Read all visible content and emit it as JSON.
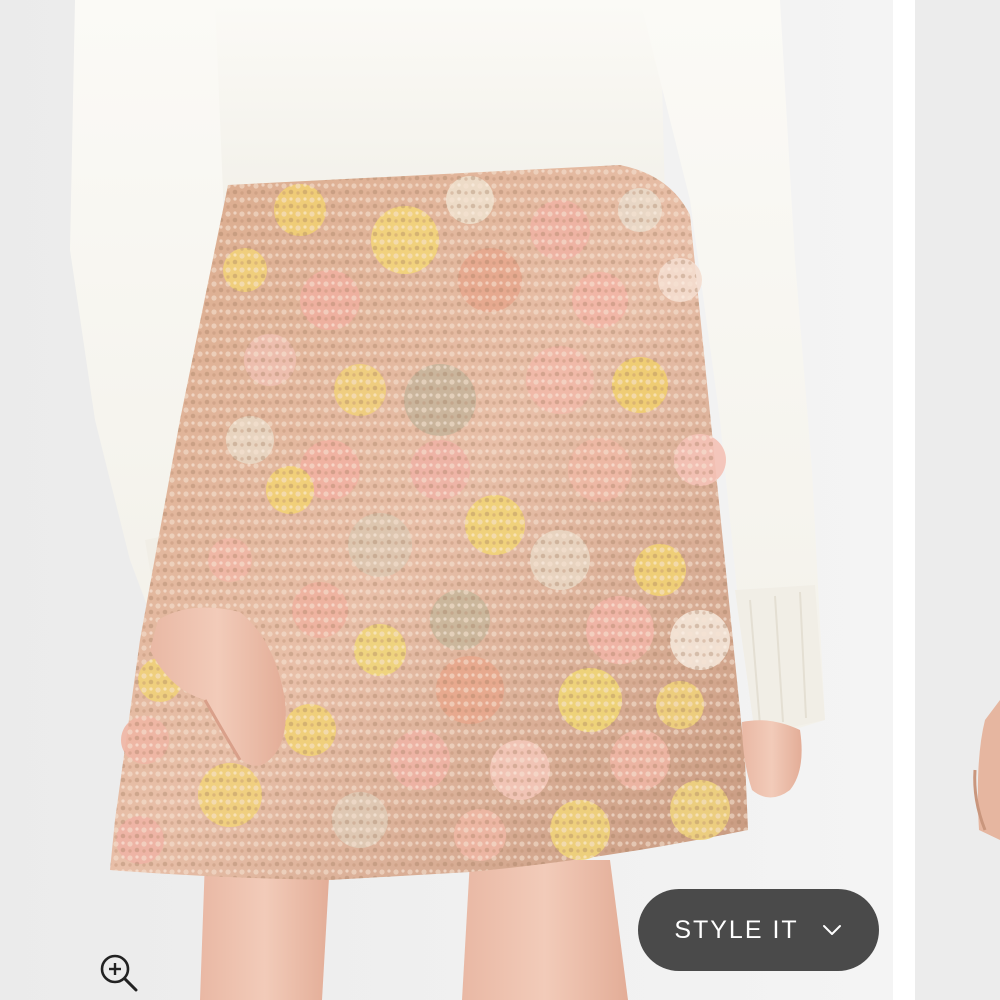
{
  "gallery": {
    "style_it_label": "STYLE IT",
    "style_it_icon": "chevron-down-icon",
    "zoom_icon": "zoom-in-icon",
    "colors": {
      "button_bg": "#4a4a4a",
      "button_text": "#ffffff"
    }
  }
}
